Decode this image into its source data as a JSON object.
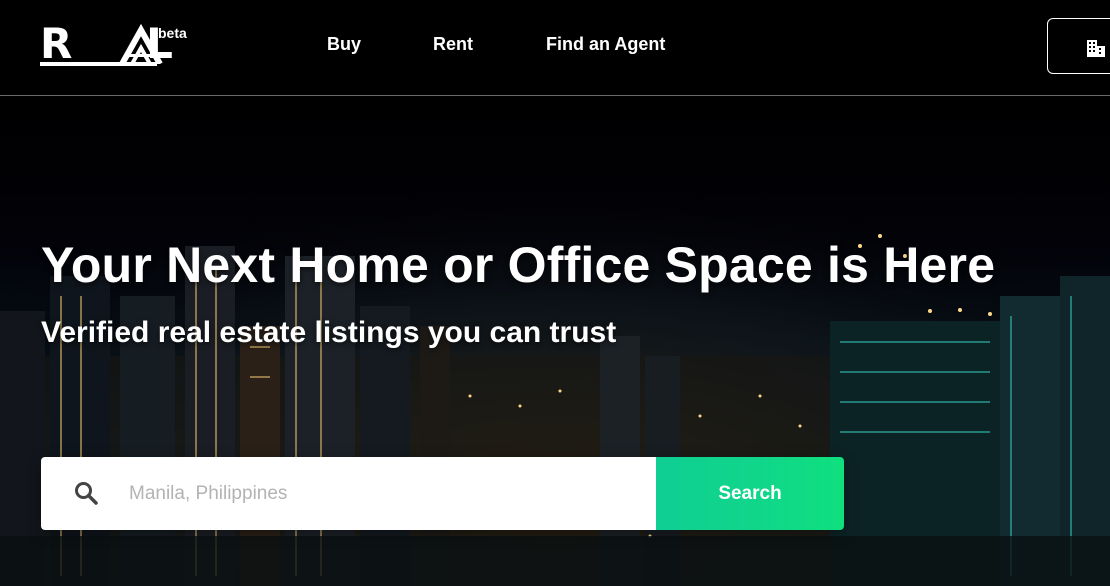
{
  "header": {
    "logo_text": "REAL",
    "logo_badge": "beta",
    "nav": [
      {
        "label": "Buy"
      },
      {
        "label": "Rent"
      },
      {
        "label": "Find an Agent"
      }
    ],
    "list_button_icon": "building-icon"
  },
  "hero": {
    "title": "Your Next Home or Office Space is Here",
    "subtitle": "Verified real estate listings you can trust",
    "search": {
      "icon": "search-icon",
      "placeholder": "Manila, Philippines",
      "value": "",
      "button_label": "Search"
    }
  },
  "colors": {
    "header_bg": "#000000",
    "accent_green": "#10d68a",
    "text_white": "#ffffff",
    "placeholder_gray": "#b3b3b3"
  }
}
